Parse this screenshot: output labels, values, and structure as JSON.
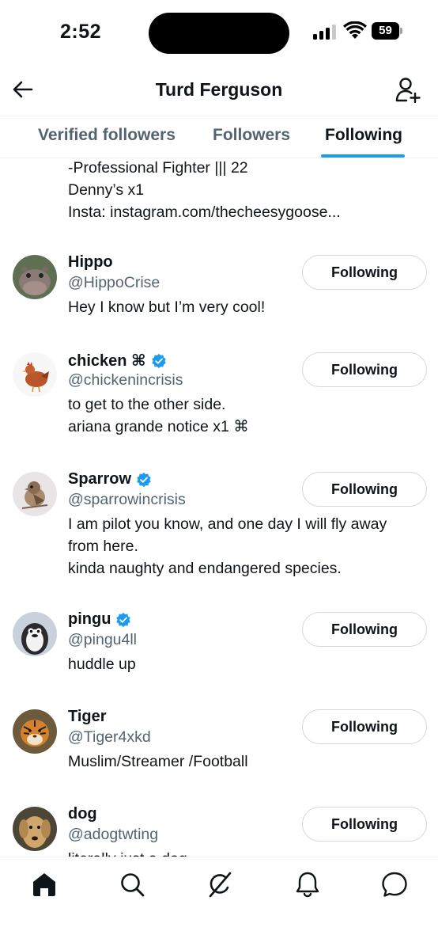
{
  "status_bar": {
    "time": "2:52",
    "battery": "59"
  },
  "header": {
    "title": "Turd Ferguson",
    "back_icon": "arrow-left-icon",
    "add_user_icon": "person-plus-icon"
  },
  "tabs": [
    {
      "label": "Verified followers",
      "active": false
    },
    {
      "label": "Followers",
      "active": false
    },
    {
      "label": "Following",
      "active": true
    }
  ],
  "partial_bio": [
    "-Professional Fighter ||| 22",
    "Denny’s x1",
    "Insta: instagram.com/thecheesygoose..."
  ],
  "users": [
    {
      "name": "Hippo",
      "handle": "@HippoCrise",
      "verified": false,
      "bio": [
        "Hey I know but I’m very cool!"
      ],
      "button_label": "Following"
    },
    {
      "name": "chicken ⌘",
      "handle": "@chickenincrisis",
      "verified": true,
      "bio": [
        "to get to the other side.",
        "ariana grande notice x1 ⌘"
      ],
      "button_label": "Following"
    },
    {
      "name": "Sparrow",
      "handle": "@sparrowincrisis",
      "verified": true,
      "bio": [
        "I am pilot you know, and one day I will fly away",
        "from here.",
        "kinda naughty and endangered species."
      ],
      "button_label": "Following"
    },
    {
      "name": "pingu",
      "handle": "@pingu4ll",
      "verified": true,
      "bio": [
        "huddle up"
      ],
      "button_label": "Following"
    },
    {
      "name": "Tiger",
      "handle": "@Tiger4xkd",
      "verified": false,
      "bio": [
        "Muslim/Streamer /Football"
      ],
      "button_label": "Following"
    },
    {
      "name": "dog",
      "handle": "@adogtwting",
      "verified": false,
      "bio": [
        "literally just a dog"
      ],
      "button_label": "Following"
    }
  ],
  "bottom_nav": [
    "home-icon",
    "search-icon",
    "grok-icon",
    "notifications-icon",
    "messages-icon"
  ],
  "colors": {
    "accent": "#1d9bf0",
    "text": "#0f1419",
    "secondary_text": "#536471",
    "border": "#cfd9de"
  }
}
